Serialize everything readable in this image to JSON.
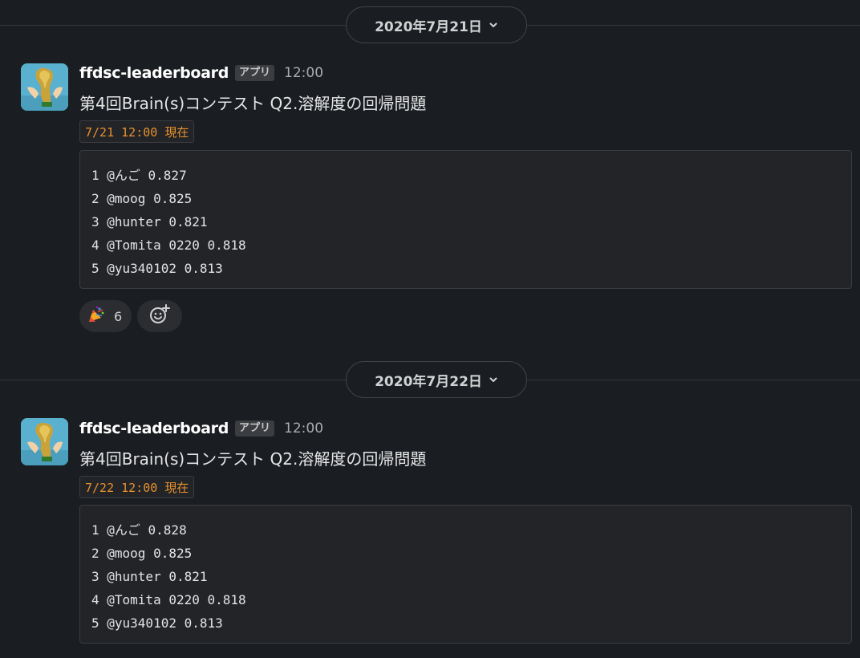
{
  "days": [
    {
      "date": "2020年7月21日",
      "message": {
        "sender": "ffdsc-leaderboard",
        "badge": "アプリ",
        "time": "12:00",
        "title": "第4回Brain(s)コンテスト Q2.溶解度の回帰問題",
        "timestamp": "7/21 12:00 現在",
        "leaderboard": [
          "1 @んご 0.827",
          "2 @moog 0.825",
          "3 @hunter 0.821",
          "4 @Tomita 0220 0.818",
          "5 @yu340102 0.813"
        ],
        "reactions": [
          {
            "emoji": "party-popper",
            "count": "6"
          }
        ]
      }
    },
    {
      "date": "2020年7月22日",
      "message": {
        "sender": "ffdsc-leaderboard",
        "badge": "アプリ",
        "time": "12:00",
        "title": "第4回Brain(s)コンテスト Q2.溶解度の回帰問題",
        "timestamp": "7/22 12:00 現在",
        "leaderboard": [
          "1 @んご 0.828",
          "2 @moog 0.825",
          "3 @hunter 0.821",
          "4 @Tomita 0220 0.818",
          "5 @yu340102 0.813"
        ]
      }
    }
  ],
  "icons": {
    "date_chevron": "chevron-down-icon",
    "avatar": "trophy-avatar",
    "reaction": "party-popper-icon",
    "add_reaction": "add-reaction-icon"
  },
  "colors": {
    "background": "#1a1d21",
    "inline_code": "#e8912d",
    "avatar_bg": "#5ab1cf"
  }
}
